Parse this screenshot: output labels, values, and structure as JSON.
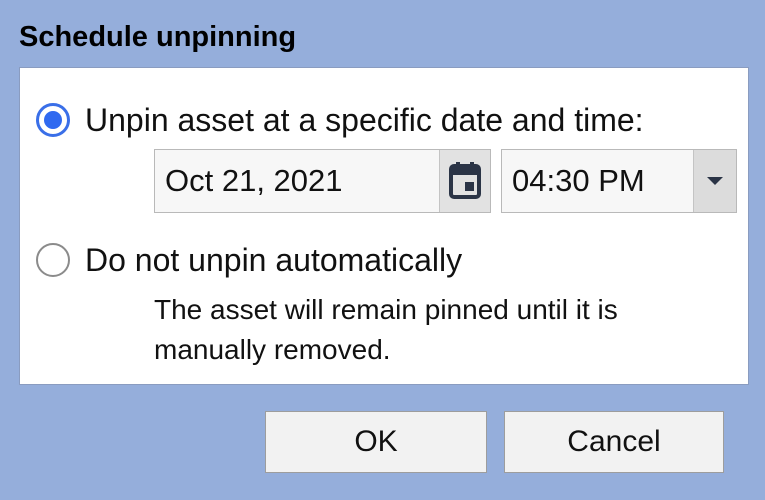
{
  "dialog": {
    "title": "Schedule unpinning"
  },
  "options": {
    "specific": {
      "label": "Unpin asset at a specific date and time:",
      "selected": true,
      "date_value": "Oct 21, 2021",
      "time_value": "04:30 PM",
      "calendar_icon": "calendar-icon",
      "dropdown_icon": "chevron-down-icon"
    },
    "never": {
      "label": "Do not unpin automatically",
      "selected": false,
      "description": "The asset will remain pinned until it is manually removed."
    }
  },
  "buttons": {
    "ok": "OK",
    "cancel": "Cancel"
  },
  "colors": {
    "background": "#95aedb",
    "radio_selected": "#2f69f0",
    "icon": "#2b3446"
  }
}
